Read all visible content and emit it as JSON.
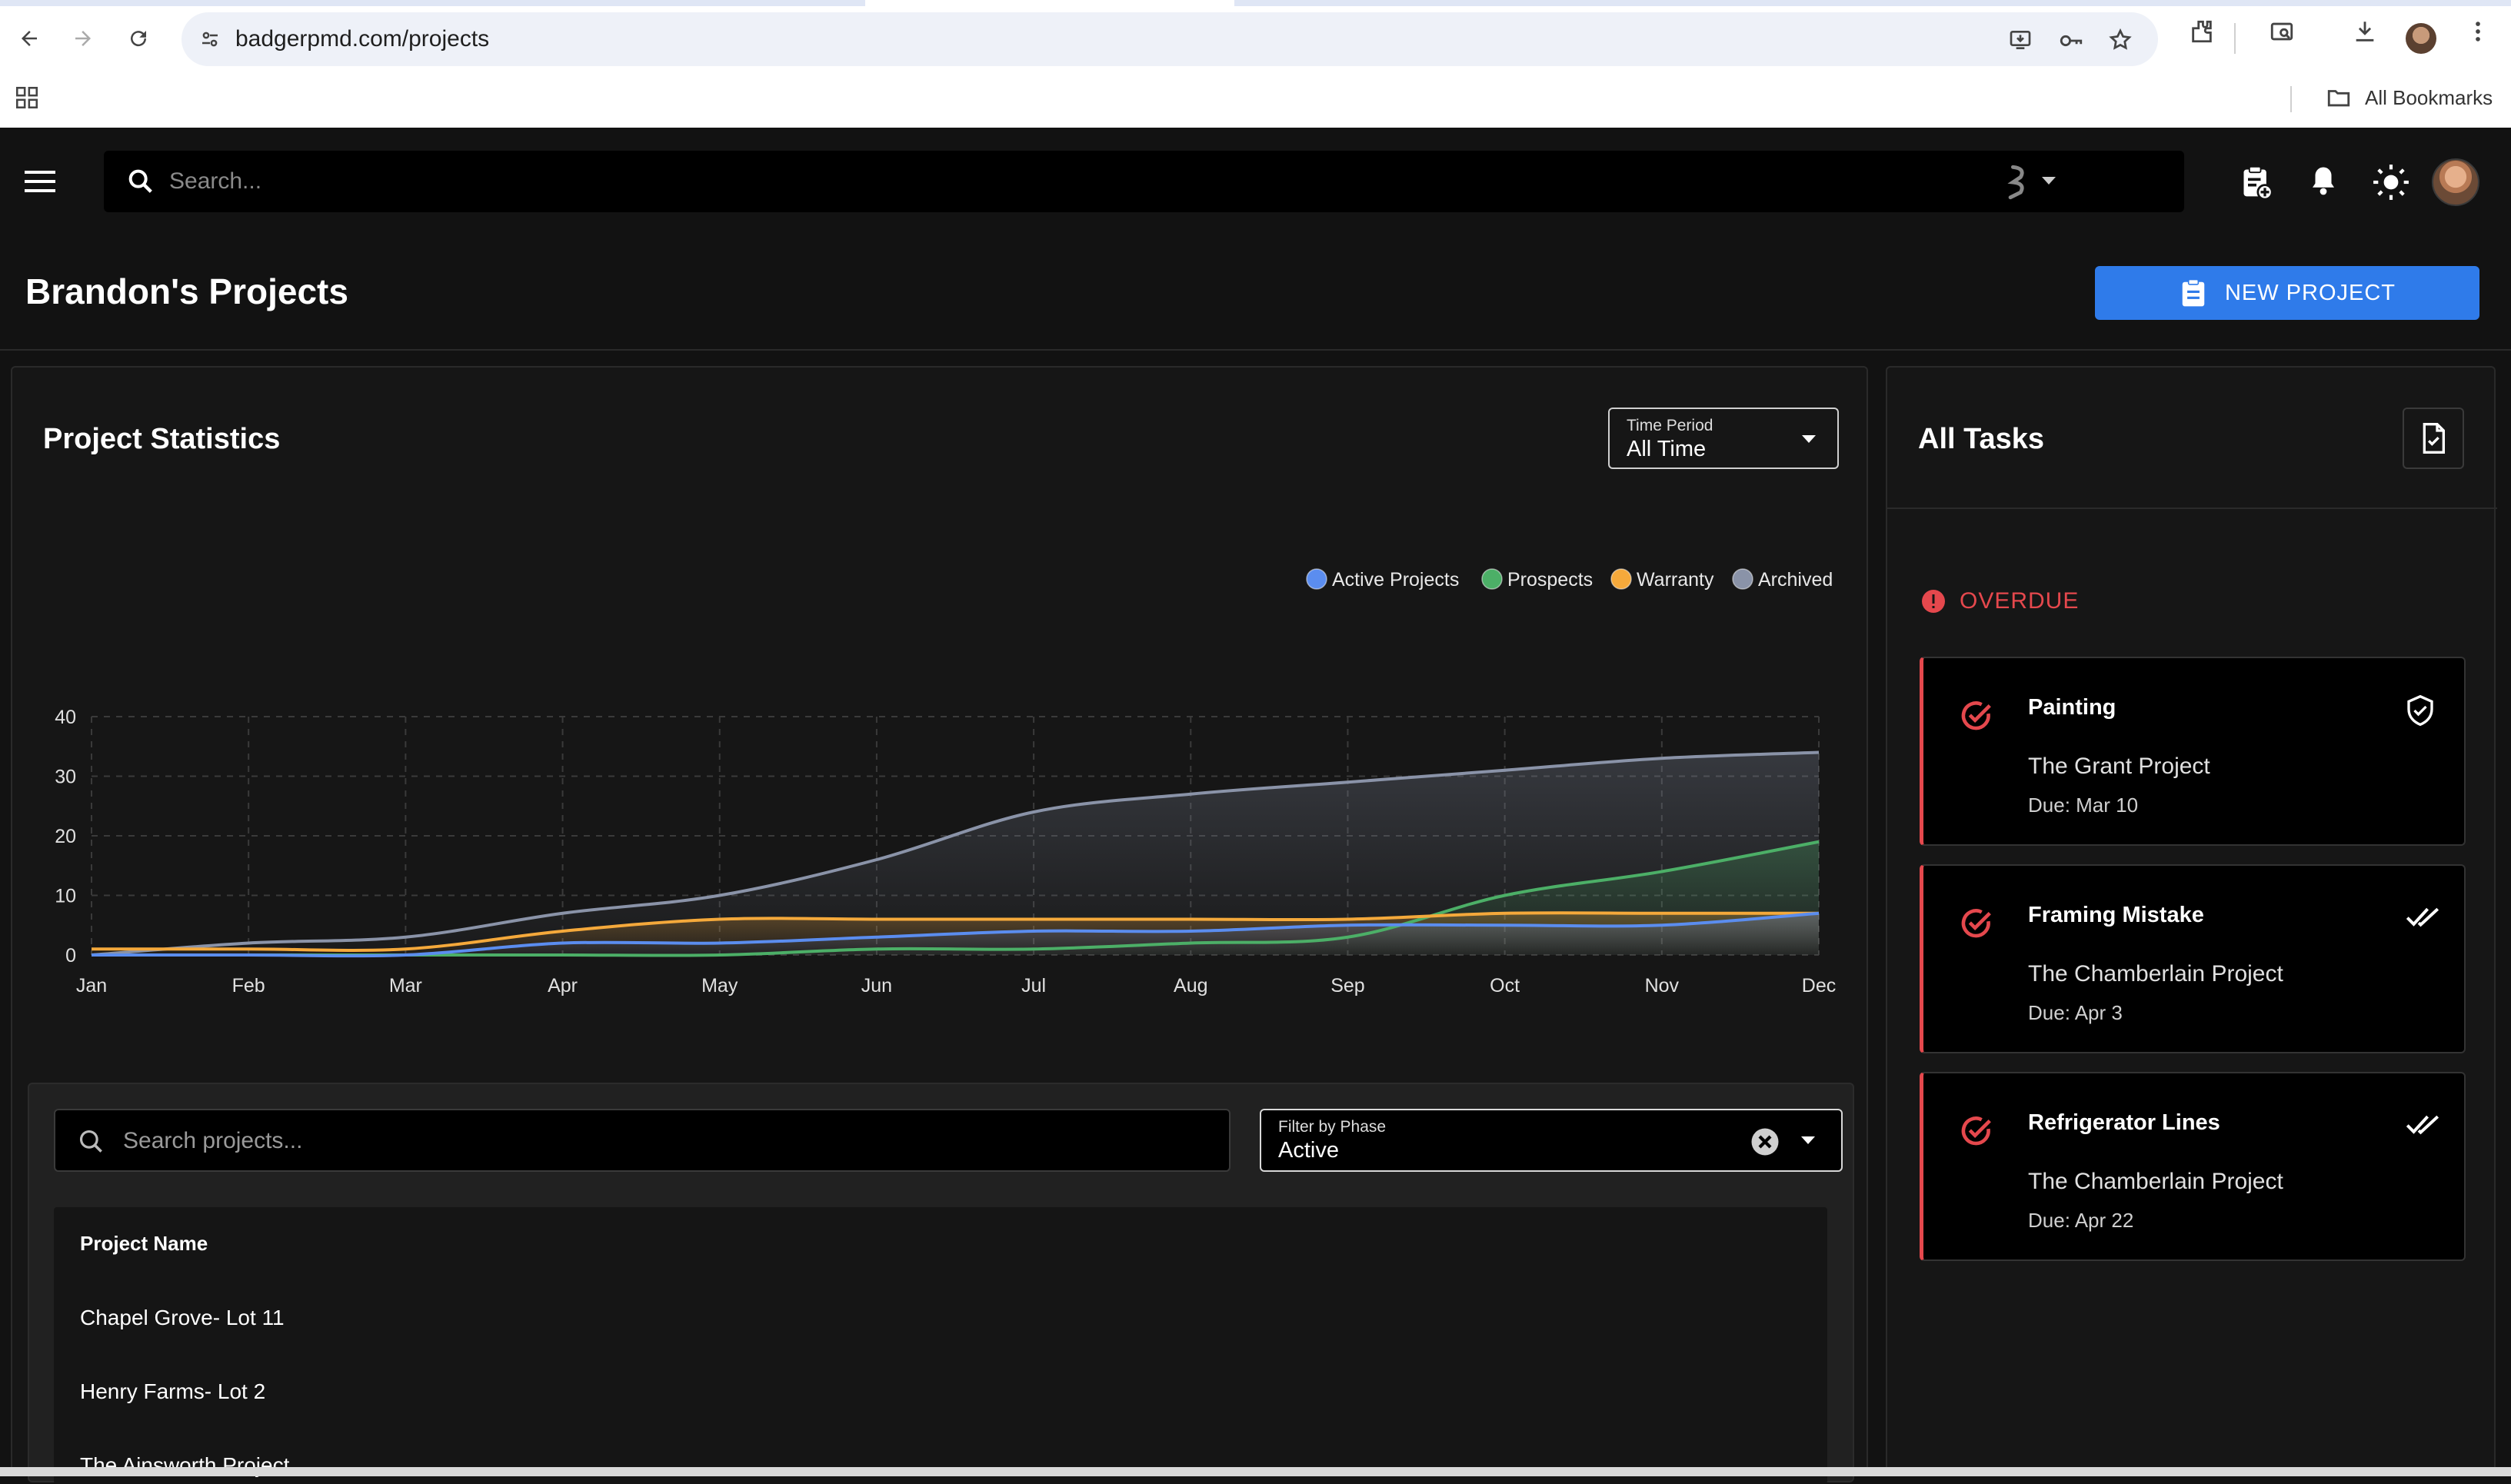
{
  "browser": {
    "url": "badgerpmd.com/projects",
    "bookmarks_label": "All Bookmarks"
  },
  "header": {
    "search_placeholder": "Search..."
  },
  "page": {
    "title": "Brandon's Projects",
    "new_project_label": "NEW PROJECT"
  },
  "stats": {
    "title": "Project Statistics",
    "time_period_label": "Time Period",
    "time_period_value": "All Time"
  },
  "chart_data": {
    "type": "area",
    "x": [
      "Jan",
      "Feb",
      "Mar",
      "Apr",
      "May",
      "Jun",
      "Jul",
      "Aug",
      "Sep",
      "Oct",
      "Nov",
      "Dec"
    ],
    "ylim": [
      0,
      40
    ],
    "yticks": [
      "0",
      "10",
      "20",
      "30",
      "40"
    ],
    "grid": true,
    "legend": "top-right",
    "series": [
      {
        "name": "Active Projects",
        "color": "#5b8def",
        "values": [
          0,
          0,
          0,
          2,
          2,
          3,
          4,
          4,
          5,
          5,
          5,
          7
        ]
      },
      {
        "name": "Prospects",
        "color": "#4caf67",
        "values": [
          0,
          0,
          0,
          0,
          0,
          1,
          1,
          2,
          3,
          10,
          14,
          19
        ]
      },
      {
        "name": "Warranty",
        "color": "#f5a93b",
        "values": [
          1,
          1,
          1,
          4,
          6,
          6,
          6,
          6,
          6,
          7,
          7,
          7
        ]
      },
      {
        "name": "Archived",
        "color": "#8a93a8",
        "values": [
          0,
          2,
          3,
          7,
          10,
          16,
          24,
          27,
          29,
          31,
          33,
          34
        ]
      }
    ]
  },
  "project_list": {
    "search_placeholder": "Search projects...",
    "filter_label": "Filter by Phase",
    "filter_value": "Active",
    "column_header": "Project Name",
    "rows": [
      "Chapel Grove- Lot 11",
      "Henry Farms- Lot 2",
      "The Ainsworth Project"
    ]
  },
  "tasks": {
    "title": "All Tasks",
    "overdue_label": "OVERDUE",
    "items": [
      {
        "title": "Painting",
        "project": "The Grant Project",
        "due": "Due: Mar 10",
        "status_icon": "shield-check-icon"
      },
      {
        "title": "Framing Mistake",
        "project": "The Chamberlain Project",
        "due": "Due: Apr 3",
        "status_icon": "double-check-icon"
      },
      {
        "title": "Refrigerator Lines",
        "project": "The Chamberlain Project",
        "due": "Due: Apr 22",
        "status_icon": "double-check-icon"
      }
    ]
  },
  "colors": {
    "accent": "#2f7bea",
    "overdue": "#e5484d",
    "background": "#121212"
  }
}
